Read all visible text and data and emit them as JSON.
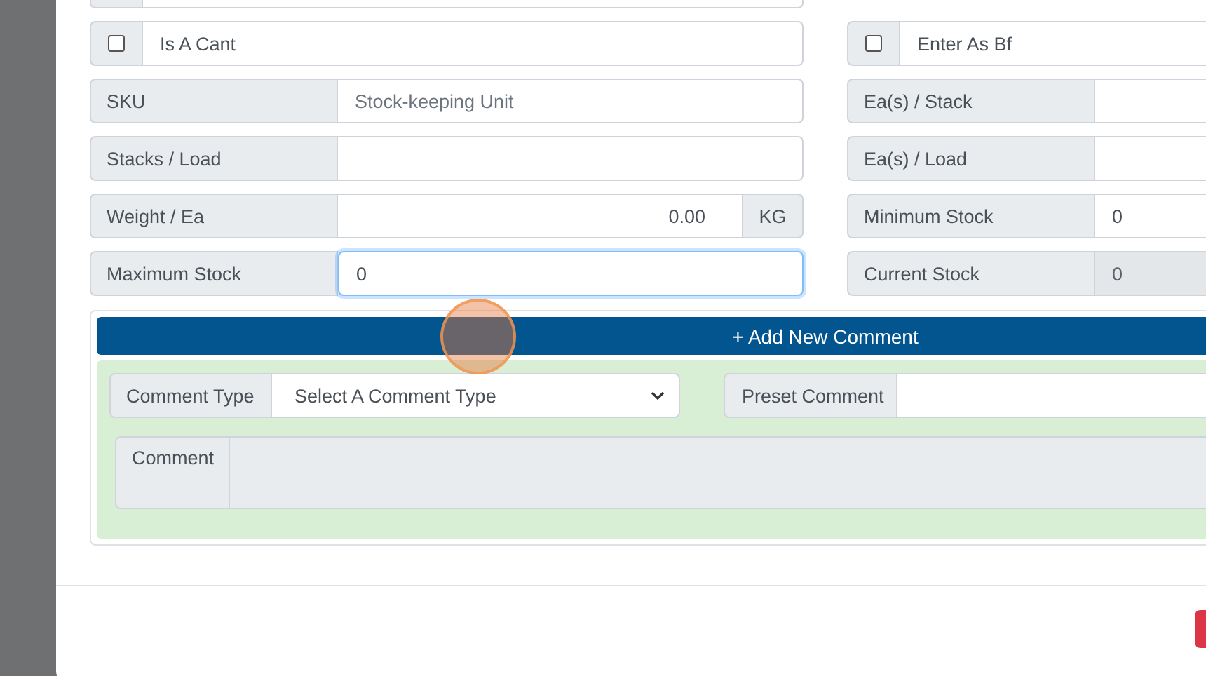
{
  "form": {
    "left": [
      {
        "kind": "checkbox",
        "label": "Is A Cant",
        "checked": false
      },
      {
        "kind": "input",
        "label": "SKU",
        "placeholder": "Stock-keeping Unit",
        "disabled": false,
        "focused": false
      },
      {
        "kind": "input",
        "label": "Stacks / Load",
        "disabled": false,
        "focused": false
      },
      {
        "kind": "unit",
        "label": "Weight / Ea",
        "value": "0.00",
        "unit": "KG",
        "disabled": false,
        "focused": false
      },
      {
        "kind": "input",
        "label": "Maximum Stock",
        "value": "0",
        "disabled": false,
        "focused": true
      }
    ],
    "right": [
      {
        "kind": "checkbox",
        "label": "Enter As Bf",
        "checked": false
      },
      {
        "kind": "input",
        "label": "Ea(s) / Stack",
        "disabled": false,
        "focused": false
      },
      {
        "kind": "input",
        "label": "Ea(s) / Load",
        "disabled": false,
        "focused": false
      },
      {
        "kind": "input",
        "label": "Minimum Stock",
        "value": "0",
        "disabled": false,
        "focused": false
      },
      {
        "kind": "input",
        "label": "Current Stock",
        "value": "0",
        "disabled": true,
        "focused": false
      }
    ]
  },
  "comments": {
    "add_button": "+ Add New Comment",
    "type_label": "Comment Type",
    "type_value": "Select A Comment Type",
    "preset_label": "Preset Comment",
    "comment_label": "Comment"
  }
}
